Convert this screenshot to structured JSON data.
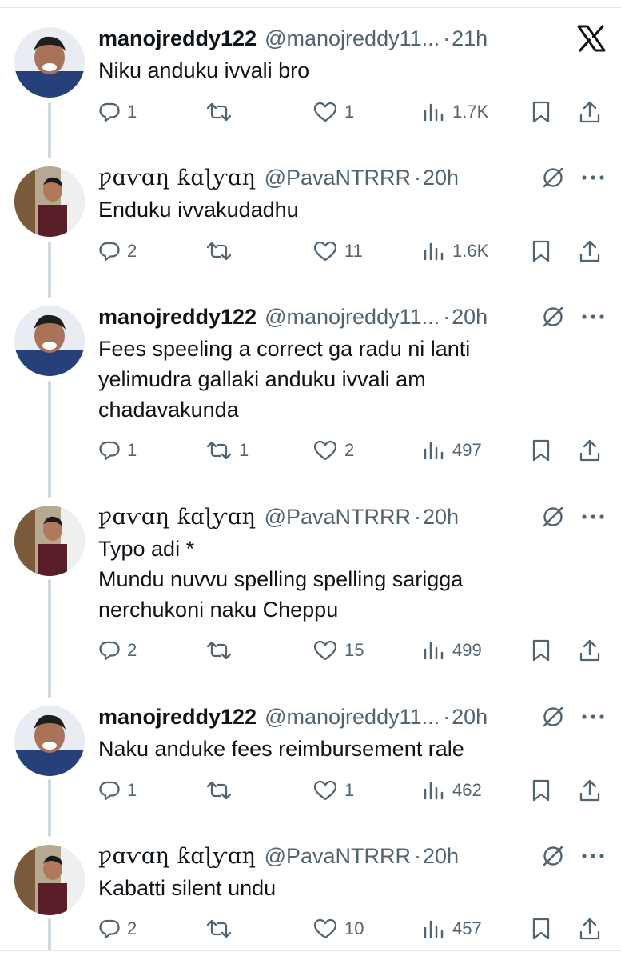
{
  "header_icon": "x-logo-icon",
  "actions_icons": {
    "reply": "reply-icon",
    "retweet": "retweet-icon",
    "like": "heart-icon",
    "views": "analytics-icon",
    "bookmark": "bookmark-icon",
    "share": "share-icon",
    "grok": "grok-icon",
    "more": "more-icon"
  },
  "tweets": [
    {
      "name": "manojreddy122",
      "handle": "@manojreddy11...",
      "dot": "·",
      "time": "21h",
      "text_lines": [
        "Niku anduku ivvali bro"
      ],
      "replies": "1",
      "retweets": "",
      "likes": "1",
      "views": "1.7K"
    },
    {
      "name": "ƿɑⱱɑƞ ƙɑɭƴɑƞ",
      "handle": "@PavaNTRRR",
      "dot": "·",
      "time": "20h",
      "text_lines": [
        "Enduku ivvakudadhu"
      ],
      "replies": "2",
      "retweets": "",
      "likes": "11",
      "views": "1.6K"
    },
    {
      "name": "manojreddy122",
      "handle": "@manojreddy11...",
      "dot": "·",
      "time": "20h",
      "text_lines": [
        "Fees speeling a correct ga radu ni lanti",
        "yelimudra gallaki anduku ivvali am",
        "chadavakunda"
      ],
      "replies": "1",
      "retweets": "1",
      "likes": "2",
      "views": "497"
    },
    {
      "name": "ƿɑⱱɑƞ ƙɑɭƴɑƞ",
      "handle": "@PavaNTRRR",
      "dot": "·",
      "time": "20h",
      "text_lines": [
        "Typo adi *",
        "Mundu nuvvu spelling spelling sarigga",
        "nerchukoni naku Cheppu"
      ],
      "replies": "2",
      "retweets": "",
      "likes": "15",
      "views": "499"
    },
    {
      "name": "manojreddy122",
      "handle": "@manojreddy11...",
      "dot": "·",
      "time": "20h",
      "text_lines": [
        "Naku anduke fees reimbursement rale"
      ],
      "replies": "1",
      "retweets": "",
      "likes": "1",
      "views": "462"
    },
    {
      "name": "ƿɑⱱɑƞ ƙɑɭƴɑƞ",
      "handle": "@PavaNTRRR",
      "dot": "·",
      "time": "20h",
      "text_lines": [
        "Kabatti silent undu"
      ],
      "replies": "2",
      "retweets": "",
      "likes": "10",
      "views": "457"
    }
  ]
}
